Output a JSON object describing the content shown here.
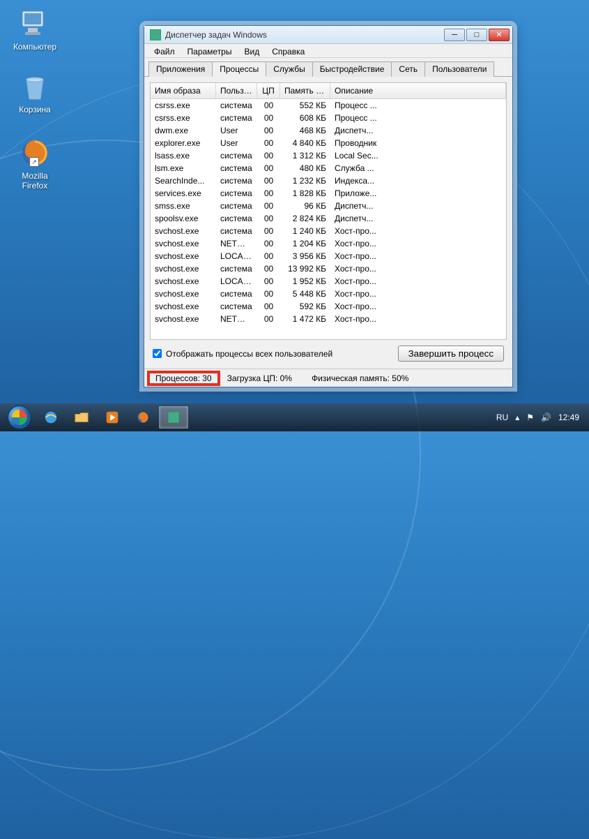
{
  "desktop": {
    "computer": "Компьютер",
    "recycle": "Корзина",
    "firefox_l1": "Mozilla",
    "firefox_l2": "Firefox"
  },
  "window": {
    "title": "Диспетчер задач Windows",
    "menu": {
      "file": "Файл",
      "options": "Параметры",
      "view": "Вид",
      "help": "Справка"
    },
    "tabs": {
      "apps": "Приложения",
      "processes": "Процессы",
      "services": "Службы",
      "perf": "Быстродействие",
      "net": "Сеть",
      "users": "Пользователи"
    },
    "cols": {
      "name": "Имя образа",
      "user": "Пользо...",
      "cpu": "ЦП",
      "mem": "Память (...",
      "desc": "Описание"
    },
    "rows": [
      {
        "name": "csrss.exe",
        "user": "система",
        "cpu": "00",
        "mem": "552 КБ",
        "desc": "Процесс ..."
      },
      {
        "name": "csrss.exe",
        "user": "система",
        "cpu": "00",
        "mem": "608 КБ",
        "desc": "Процесс ..."
      },
      {
        "name": "dwm.exe",
        "user": "User",
        "cpu": "00",
        "mem": "468 КБ",
        "desc": "Диспетч..."
      },
      {
        "name": "explorer.exe",
        "user": "User",
        "cpu": "00",
        "mem": "4 840 КБ",
        "desc": "Проводник"
      },
      {
        "name": "lsass.exe",
        "user": "система",
        "cpu": "00",
        "mem": "1 312 КБ",
        "desc": "Local Sec..."
      },
      {
        "name": "lsm.exe",
        "user": "система",
        "cpu": "00",
        "mem": "480 КБ",
        "desc": "Служба ..."
      },
      {
        "name": "SearchInde...",
        "user": "система",
        "cpu": "00",
        "mem": "1 232 КБ",
        "desc": "Индекса..."
      },
      {
        "name": "services.exe",
        "user": "система",
        "cpu": "00",
        "mem": "1 828 КБ",
        "desc": "Приложе..."
      },
      {
        "name": "smss.exe",
        "user": "система",
        "cpu": "00",
        "mem": "96 КБ",
        "desc": "Диспетч..."
      },
      {
        "name": "spoolsv.exe",
        "user": "система",
        "cpu": "00",
        "mem": "2 824 КБ",
        "desc": "Диспетч..."
      },
      {
        "name": "svchost.exe",
        "user": "система",
        "cpu": "00",
        "mem": "1 240 КБ",
        "desc": "Хост-про..."
      },
      {
        "name": "svchost.exe",
        "user": "NETWO...",
        "cpu": "00",
        "mem": "1 204 КБ",
        "desc": "Хост-про..."
      },
      {
        "name": "svchost.exe",
        "user": "LOCAL ...",
        "cpu": "00",
        "mem": "3 956 КБ",
        "desc": "Хост-про..."
      },
      {
        "name": "svchost.exe",
        "user": "система",
        "cpu": "00",
        "mem": "13 992 КБ",
        "desc": "Хост-про..."
      },
      {
        "name": "svchost.exe",
        "user": "LOCAL ...",
        "cpu": "00",
        "mem": "1 952 КБ",
        "desc": "Хост-про..."
      },
      {
        "name": "svchost.exe",
        "user": "система",
        "cpu": "00",
        "mem": "5 448 КБ",
        "desc": "Хост-про..."
      },
      {
        "name": "svchost.exe",
        "user": "система",
        "cpu": "00",
        "mem": "592 КБ",
        "desc": "Хост-про..."
      },
      {
        "name": "svchost.exe",
        "user": "NETWO...",
        "cpu": "00",
        "mem": "1 472 КБ",
        "desc": "Хост-про..."
      }
    ],
    "show_all": "Отображать процессы всех пользователей",
    "end_process": "Завершить процесс",
    "status": {
      "procs": "Процессов: 30",
      "cpu": "Загрузка ЦП: 0%",
      "mem": "Физическая память: 50%"
    }
  },
  "taskbar": {
    "lang": "RU",
    "clock": "12:49"
  }
}
